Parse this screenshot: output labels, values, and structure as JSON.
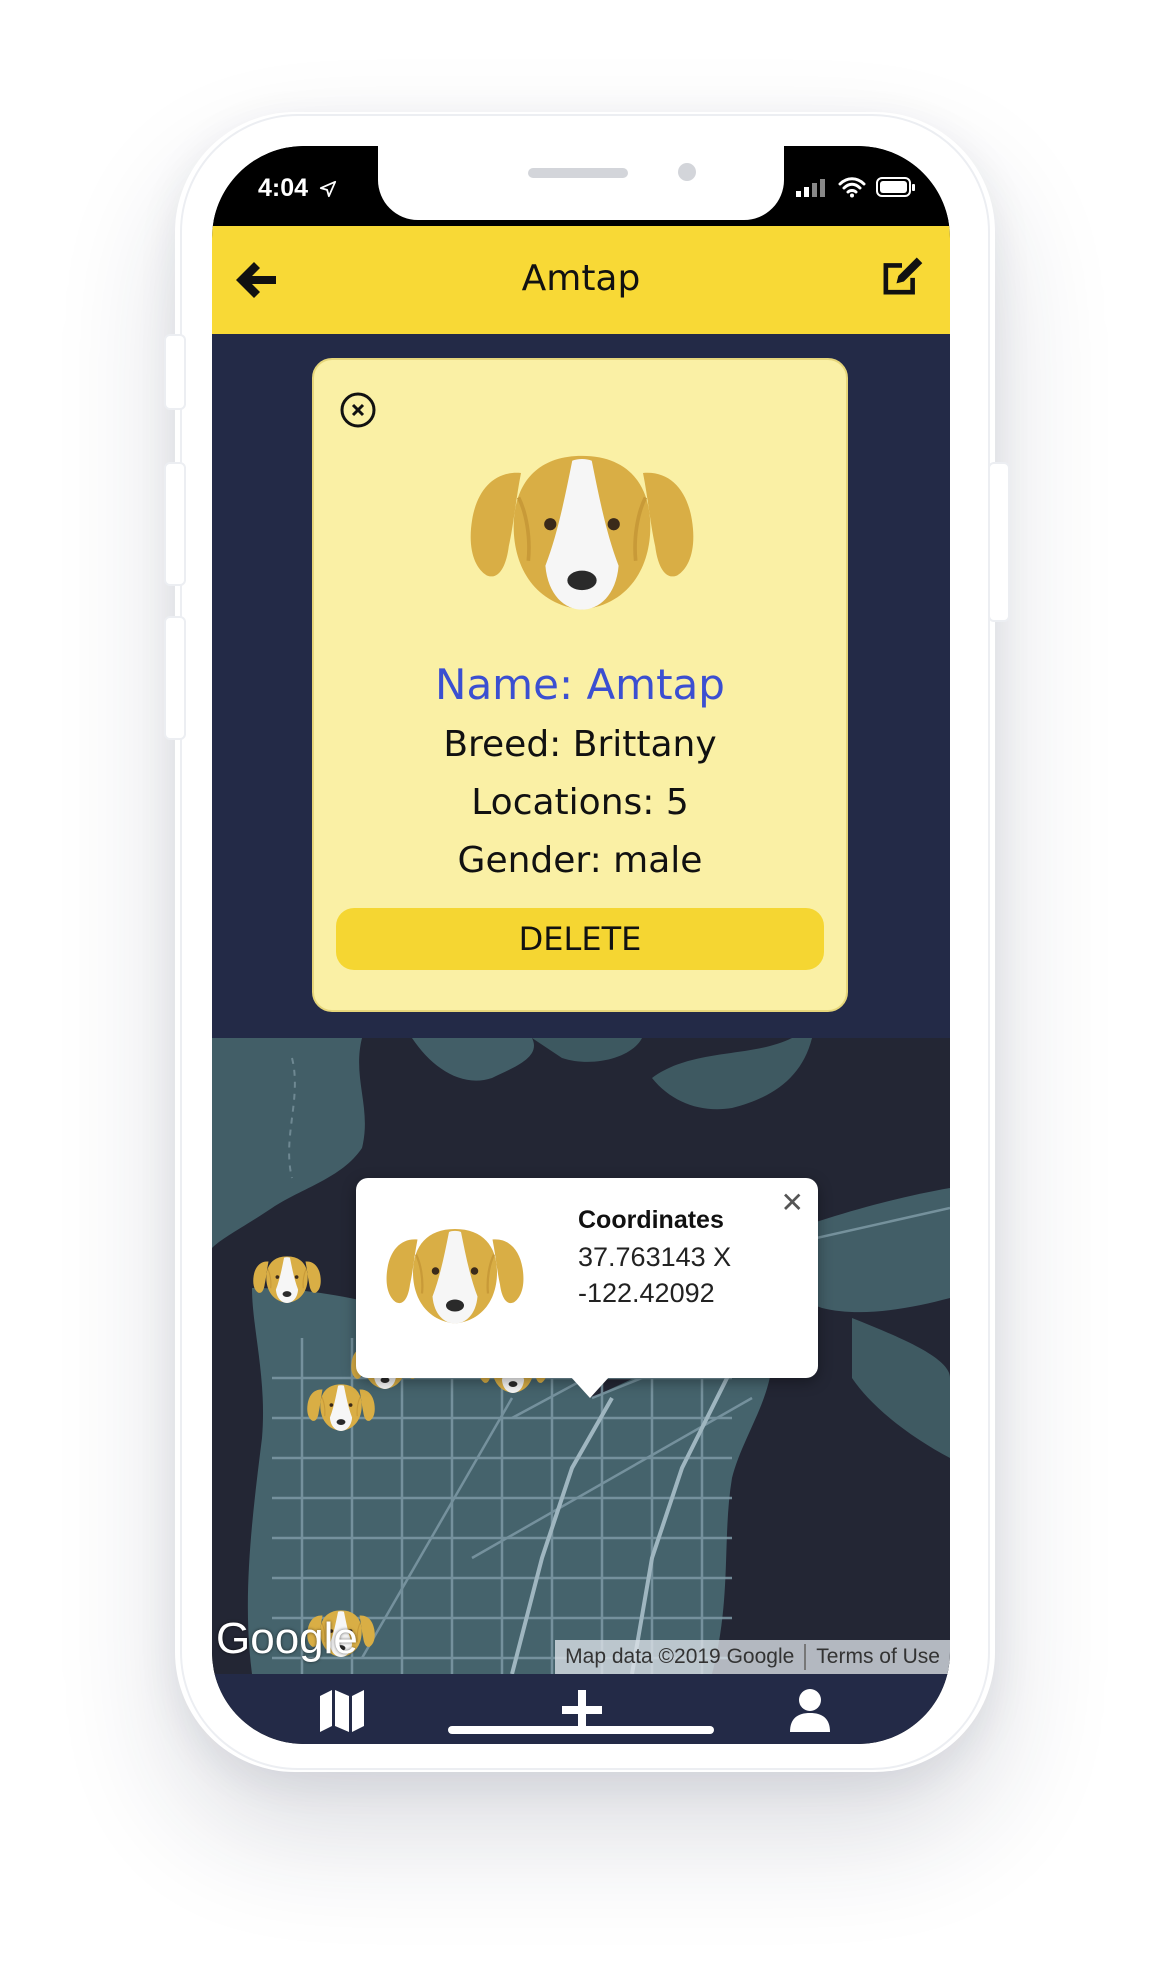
{
  "status_bar": {
    "time": "4:04"
  },
  "header": {
    "title": "Amtap"
  },
  "dog_card": {
    "name": "Name: Amtap",
    "breed": "Breed: Brittany",
    "locations": "Locations: 5",
    "gender": "Gender: male",
    "delete_label": "DELETE"
  },
  "map": {
    "info_window": {
      "heading": "Coordinates",
      "latitude_line": "37.763143 X",
      "longitude_line": "-122.42092",
      "close_glyph": "✕"
    },
    "google_logo": "Google",
    "attribution": "Map data ©2019 Google",
    "terms": "Terms of Use"
  },
  "tab_bar": {
    "items": [
      "map-icon",
      "plus-icon",
      "user-icon"
    ]
  },
  "icons": [
    "back-arrow-icon",
    "edit-icon",
    "close-circle-icon",
    "signal-icon",
    "wifi-icon",
    "battery-icon",
    "location-arrow-icon"
  ],
  "colors": {
    "header": "#f8d936",
    "dark_bg": "#232a47",
    "card_bg": "#faf0a5",
    "name_text": "#3b4fd1",
    "button": "#f5d632"
  }
}
